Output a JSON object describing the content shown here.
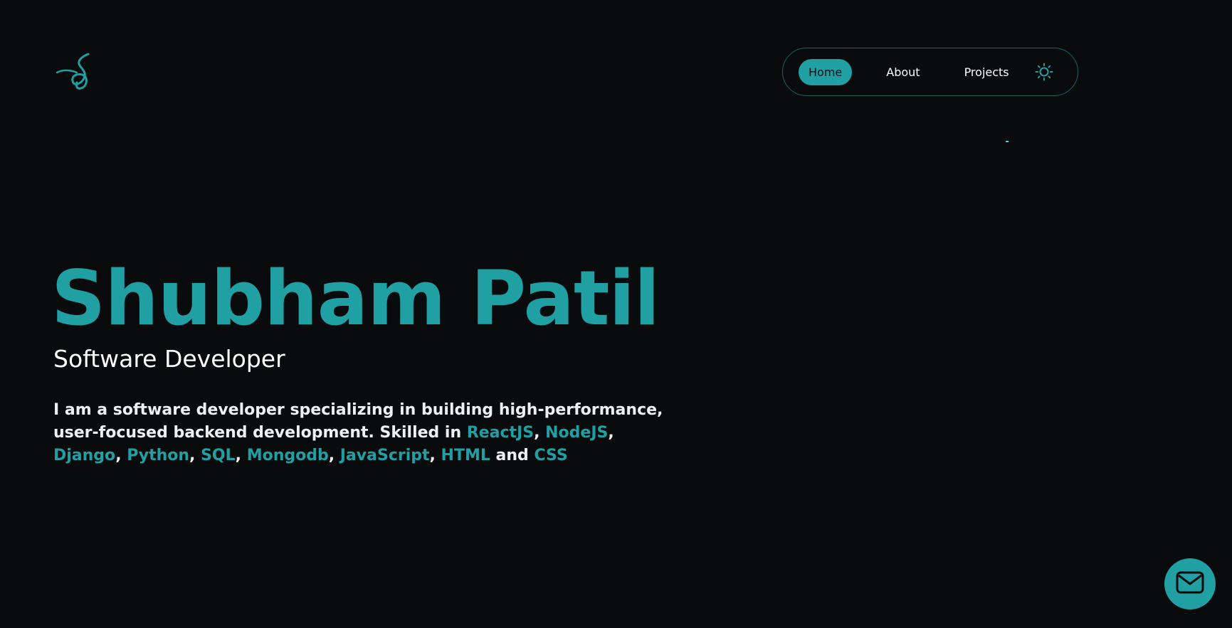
{
  "colors": {
    "background": "#0a0b0d",
    "accent": "#21a0a4",
    "text": "#ffffff"
  },
  "logo": {
    "icon": "signature-logo-icon"
  },
  "nav": {
    "items": [
      {
        "label": "Home",
        "active": true
      },
      {
        "label": "About",
        "active": false
      },
      {
        "label": "Projects",
        "active": false
      }
    ],
    "theme_toggle_icon": "sun-icon"
  },
  "hero": {
    "name": "Shubham Patil",
    "role": "Software Developer",
    "description_intro": "I am a software developer specializing in building high-performance, user-focused backend development. Skilled in ",
    "skills": [
      "ReactJS",
      "NodeJS",
      "Django",
      "Python",
      "SQL",
      "Mongodb",
      "JavaScript",
      "HTML",
      "CSS"
    ],
    "sep_comma": ", ",
    "sep_and": " and "
  },
  "contact": {
    "icon": "mail-icon"
  }
}
